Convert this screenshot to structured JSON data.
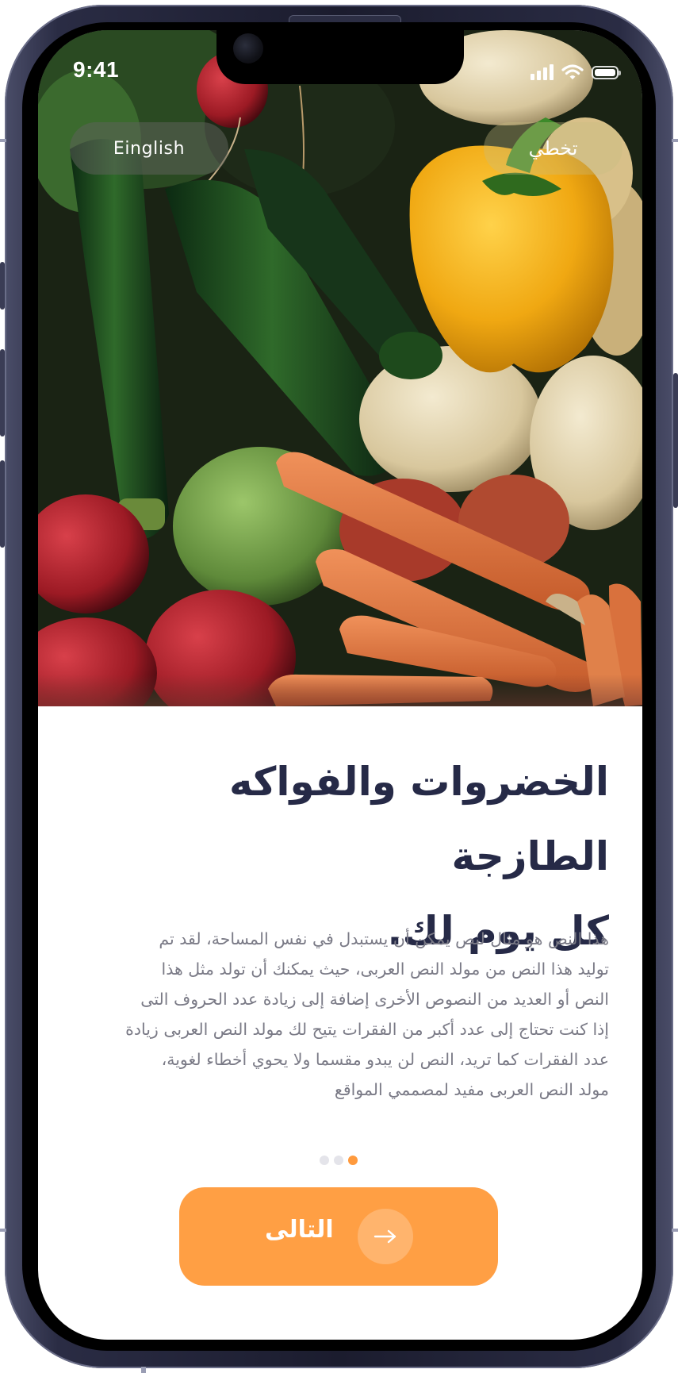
{
  "status_bar": {
    "time": "9:41"
  },
  "header": {
    "language_label": "Einglish",
    "skip_label": "تخطي"
  },
  "onboarding": {
    "title_lines": [
      "الخضروات والفواكه الطازجة",
      "كل يوم لك."
    ],
    "body_lines": [
      "هذا النص هو مثال لنص يمكن أن يستبدل في نفس المساحة، لقد تم",
      "توليد هذا النص من مولد النص العربى، حيث يمكنك أن تولد مثل هذا",
      "النص أو العديد من النصوص الأخرى إضافة إلى زيادة عدد الحروف التى",
      "إذا كنت تحتاج إلى عدد أكبر من الفقرات يتيح لك مولد النص العربى زيادة",
      "عدد الفقرات كما تريد، النص لن يبدو مقسما ولا يحوي أخطاء لغوية،",
      "مولد النص العربى مفيد لمصممي المواقع"
    ],
    "page_indicator": {
      "total": 3,
      "active_index": 2
    },
    "next_label": "التالى"
  },
  "colors": {
    "accent": "#ff9f44",
    "title": "#262a47",
    "body": "#7a7a86",
    "dot_inactive": "#e4e4ea"
  },
  "icons": {
    "next": "arrow-right-icon",
    "status": [
      "cellular-signal-icon",
      "wifi-icon",
      "battery-icon"
    ]
  }
}
